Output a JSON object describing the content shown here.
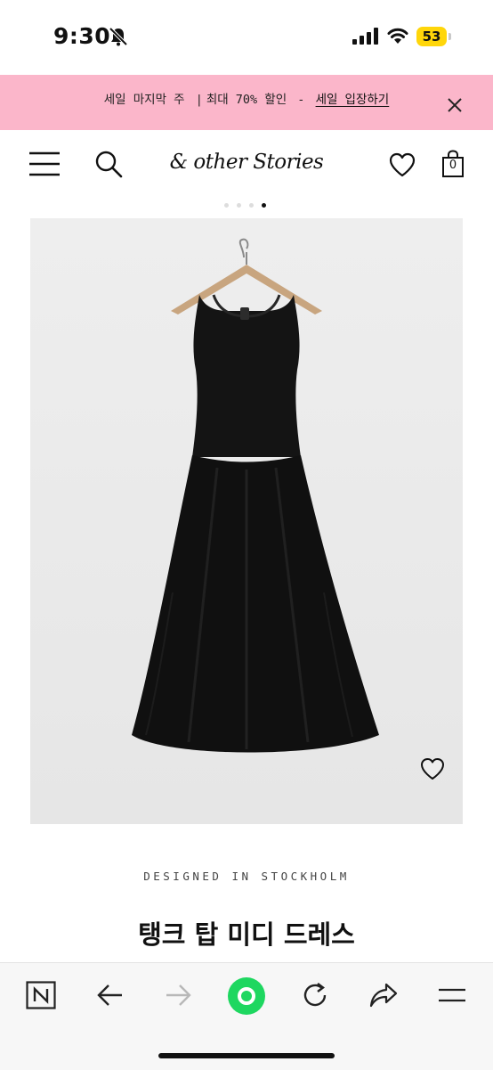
{
  "status_bar": {
    "time": "9:30",
    "battery": "53",
    "icons": [
      "bell-slash-icon",
      "signal-icon",
      "wifi-icon",
      "battery-icon"
    ],
    "battery_color": "#ffd60a"
  },
  "promo_banner": {
    "text": "세일 마지막 주",
    "separator": "|",
    "discount": "최대 70% 할인",
    "dash": "-",
    "link_label": "세일 입장하기",
    "background": "#fbb6ca",
    "close_icon": "close-icon"
  },
  "header": {
    "logo": "& other Stories",
    "bag_count": "0",
    "icons": [
      "menu-icon",
      "search-icon",
      "heart-icon",
      "shopping-bag-icon"
    ]
  },
  "carousel": {
    "total": 4,
    "active_index": 3
  },
  "product": {
    "designed_label": "DESIGNED IN STOCKHOLM",
    "title": "탱크 탑 미디 드레스",
    "wishlist_icon": "heart-icon"
  },
  "browser_toolbar": {
    "icons": [
      "naver-n-icon",
      "back-arrow-icon",
      "forward-arrow-icon",
      "home-green-icon",
      "reload-icon",
      "share-icon",
      "menu-icon"
    ],
    "accent": "#1ed760"
  }
}
